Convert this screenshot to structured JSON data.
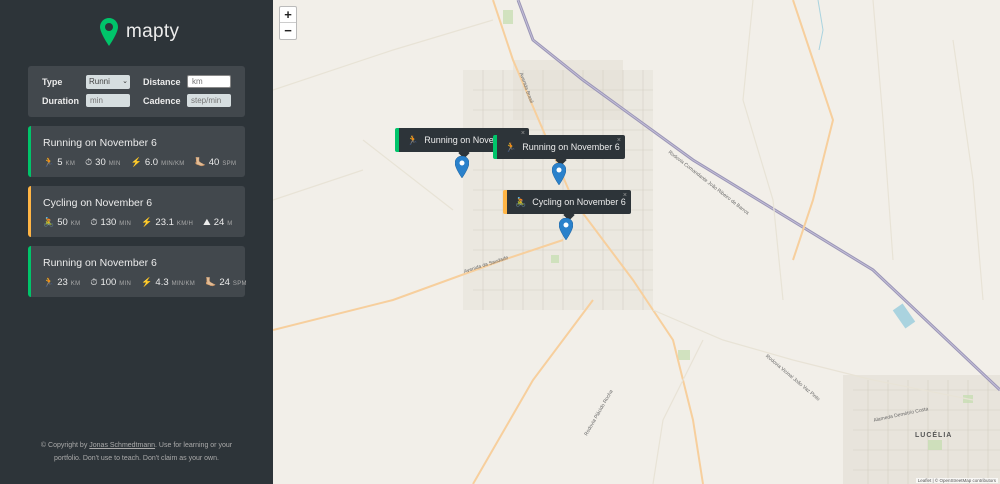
{
  "app": {
    "name": "mapty"
  },
  "form": {
    "type_label": "Type",
    "type_value": "Runni",
    "distance_label": "Distance",
    "distance_placeholder": "km",
    "duration_label": "Duration",
    "duration_placeholder": "min",
    "cadence_label": "Cadence",
    "cadence_placeholder": "step/min"
  },
  "workouts": [
    {
      "title": "Running on November 6",
      "kind": "running",
      "stats": [
        {
          "icon": "runner-icon",
          "glyph": "🏃",
          "value": "5",
          "unit": "KM"
        },
        {
          "icon": "stopwatch-icon",
          "glyph": "⏱",
          "value": "30",
          "unit": "MIN"
        },
        {
          "icon": "lightning-icon",
          "glyph": "⚡️",
          "value": "6.0",
          "unit": "MIN/KM"
        },
        {
          "icon": "footprint-icon",
          "glyph": "🦶🏼",
          "value": "40",
          "unit": "SPM"
        }
      ]
    },
    {
      "title": "Cycling on November 6",
      "kind": "cycling",
      "stats": [
        {
          "icon": "cyclist-icon",
          "glyph": "🚴",
          "value": "50",
          "unit": "KM"
        },
        {
          "icon": "stopwatch-icon",
          "glyph": "⏱",
          "value": "130",
          "unit": "MIN"
        },
        {
          "icon": "lightning-icon",
          "glyph": "⚡️",
          "value": "23.1",
          "unit": "KM/H"
        },
        {
          "icon": "mountain-icon",
          "glyph": "⛰",
          "value": "24",
          "unit": "M"
        }
      ]
    },
    {
      "title": "Running on November 6",
      "kind": "running",
      "stats": [
        {
          "icon": "runner-icon",
          "glyph": "🏃",
          "value": "23",
          "unit": "KM"
        },
        {
          "icon": "stopwatch-icon",
          "glyph": "⏱",
          "value": "100",
          "unit": "MIN"
        },
        {
          "icon": "lightning-icon",
          "glyph": "⚡️",
          "value": "4.3",
          "unit": "MIN/KM"
        },
        {
          "icon": "footprint-icon",
          "glyph": "🦶🏼",
          "value": "24",
          "unit": "SPM"
        }
      ]
    }
  ],
  "copyright": {
    "prefix": "© Copyright by ",
    "author": "Jonas Schmedtmann",
    "suffix": ". Use for learning or your portfolio. Don't use to teach. Don't claim as your own."
  },
  "map": {
    "zoom_in": "+",
    "zoom_out": "−",
    "popups": [
      {
        "text": "Running on November 6",
        "glyph": "🏃",
        "kind": "running"
      },
      {
        "text": "Running on November 6",
        "glyph": "🏃",
        "kind": "running"
      },
      {
        "text": "Cycling on November 6",
        "glyph": "🚴",
        "kind": "cycling"
      }
    ],
    "close_glyph": "×",
    "place_label": "LUCÉLIA",
    "road_labels": [
      "Avenida da Saudade",
      "Rodovia Comandante João Ribeiro de Barros",
      "Rodovia Vicinal João Vaz Pinto",
      "Alameda Demétrio Costa",
      "Rodovia Plácido Rocha",
      "Avenida Brasil"
    ],
    "attribution": "Leaflet | © OpenStreetMap contributors"
  },
  "colors": {
    "running": "#00c46a",
    "cycling": "#ffb545",
    "sidebar": "#2d3439",
    "card": "#42484d",
    "marker": "#2a81cb"
  }
}
